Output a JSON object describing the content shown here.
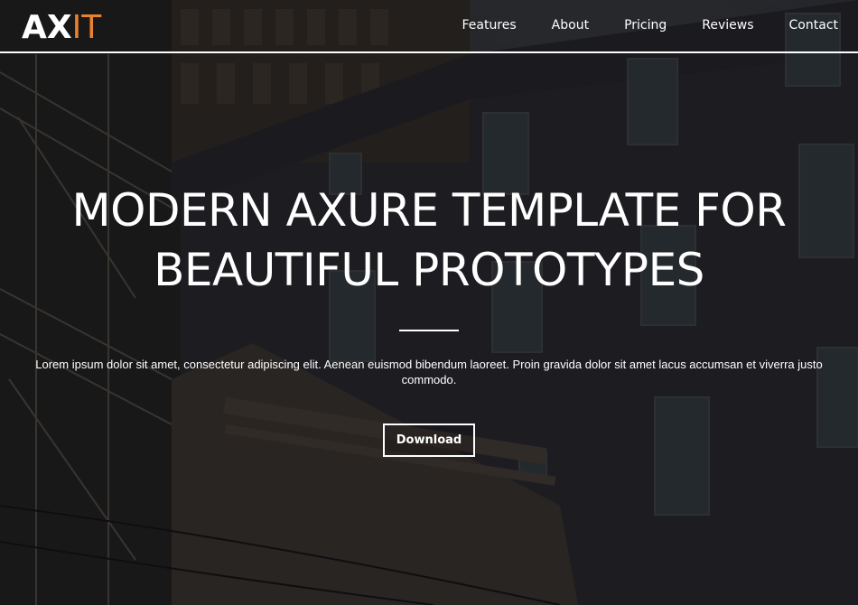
{
  "header": {
    "logo_part1": "AX",
    "logo_part2": "IT",
    "logo_accent_color": "#e8822e",
    "nav": [
      {
        "label": "Features"
      },
      {
        "label": "About"
      },
      {
        "label": "Pricing"
      },
      {
        "label": "Reviews"
      },
      {
        "label": "Contact"
      }
    ]
  },
  "hero": {
    "headline_line1": "MODERN AXURE TEMPLATE FOR",
    "headline_line2": "BEAUTIFUL PROTOTYPES",
    "description": "Lorem ipsum dolor sit amet, consectetur adipiscing elit. Aenean euismod bibendum laoreet. Proin gravida dolor sit amet lacus accumsan et viverra justo commodo.",
    "cta_label": "Download"
  }
}
